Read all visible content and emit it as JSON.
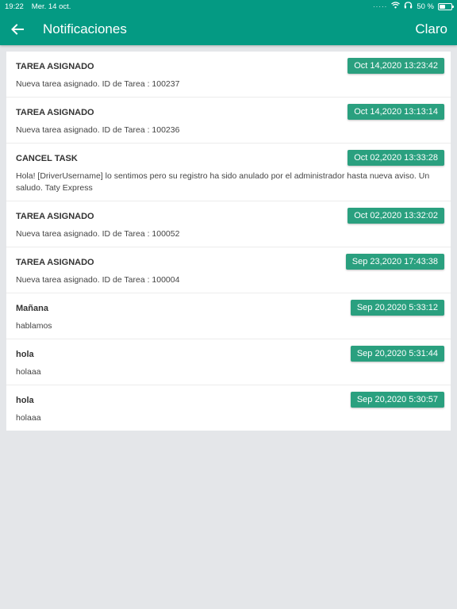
{
  "status": {
    "time": "19:22",
    "date": "Mer. 14 oct.",
    "battery": "50 %",
    "battery_level": 0.5
  },
  "header": {
    "title": "Notificaciones",
    "clear_label": "Claro"
  },
  "notifications": [
    {
      "title": "TAREA ASIGNADO",
      "date": "Oct 14,2020 13:23:42",
      "body": "Nueva tarea asignado. ID de Tarea : 100237"
    },
    {
      "title": "TAREA ASIGNADO",
      "date": "Oct 14,2020 13:13:14",
      "body": "Nueva tarea asignado. ID de Tarea : 100236"
    },
    {
      "title": "CANCEL TASK",
      "date": "Oct 02,2020 13:33:28",
      "body": "Hola! [DriverUsername] lo sentimos pero su registro ha sido anulado por el administrador hasta nueva aviso. Un saludo. Taty Express"
    },
    {
      "title": "TAREA ASIGNADO",
      "date": "Oct 02,2020 13:32:02",
      "body": "Nueva tarea asignado. ID de Tarea : 100052"
    },
    {
      "title": "TAREA ASIGNADO",
      "date": "Sep 23,2020 17:43:38",
      "body": "Nueva tarea asignado. ID de Tarea : 100004"
    },
    {
      "title": "Mañana",
      "date": "Sep 20,2020 5:33:12",
      "body": "hablamos"
    },
    {
      "title": "hola",
      "date": "Sep 20,2020 5:31:44",
      "body": "holaaa"
    },
    {
      "title": "hola",
      "date": "Sep 20,2020 5:30:57",
      "body": "holaaa"
    }
  ],
  "colors": {
    "accent": "#049a83",
    "badge": "#2aa07f",
    "background": "#e4e6e9"
  },
  "icons": {
    "back": "arrow-left-icon",
    "wifi": "wifi-icon",
    "headphones": "headphones-icon",
    "battery": "battery-icon"
  }
}
